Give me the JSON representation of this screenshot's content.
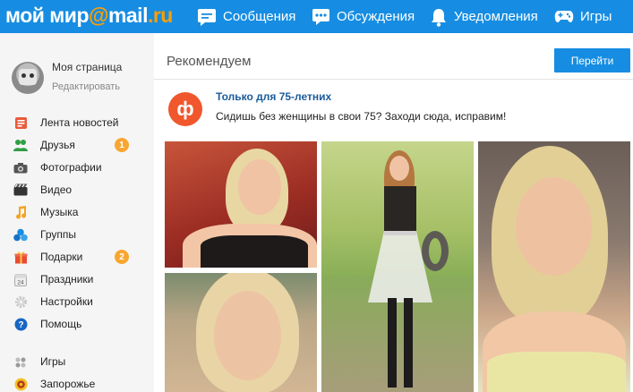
{
  "header": {
    "logo_prefix": "мой мир",
    "logo_at": "@",
    "logo_mail": "mail",
    "logo_dot_ru": ".ru",
    "nav": [
      {
        "label": "Сообщения",
        "icon": "chat-icon"
      },
      {
        "label": "Обсуждения",
        "icon": "discussion-icon"
      },
      {
        "label": "Уведомления",
        "icon": "bell-icon"
      },
      {
        "label": "Игры",
        "icon": "gamepad-icon"
      }
    ]
  },
  "sidebar": {
    "profile": {
      "name": "Моя страница",
      "edit": "Редактировать"
    },
    "items": [
      {
        "label": "Лента новостей",
        "icon": "news-feed-icon",
        "badge": null
      },
      {
        "label": "Друзья",
        "icon": "friends-icon",
        "badge": "1"
      },
      {
        "label": "Фотографии",
        "icon": "camera-icon",
        "badge": null
      },
      {
        "label": "Видео",
        "icon": "film-icon",
        "badge": null
      },
      {
        "label": "Музыка",
        "icon": "music-note-icon",
        "badge": null
      },
      {
        "label": "Группы",
        "icon": "groups-icon",
        "badge": null
      },
      {
        "label": "Подарки",
        "icon": "gift-icon",
        "badge": "2"
      },
      {
        "label": "Праздники",
        "icon": "calendar-icon",
        "badge": null
      },
      {
        "label": "Настройки",
        "icon": "gear-icon",
        "badge": null
      },
      {
        "label": "Помощь",
        "icon": "help-icon",
        "badge": null
      },
      {
        "label": "Игры",
        "icon": "game-icon",
        "badge": null
      },
      {
        "label": "Запорожье",
        "icon": "city-icon",
        "badge": null
      }
    ]
  },
  "main": {
    "title": "Рекомендуем",
    "button": "Перейти",
    "promo": {
      "icon_letter": "ф",
      "title": "Только для 75-летних",
      "text": "Сидишь без женщины в свои 75? Заходи сюда, исправим!"
    }
  },
  "colors": {
    "brand": "#168de2",
    "accent": "#ff9e00",
    "badge": "#f7a731",
    "promo": "#f0572c"
  }
}
